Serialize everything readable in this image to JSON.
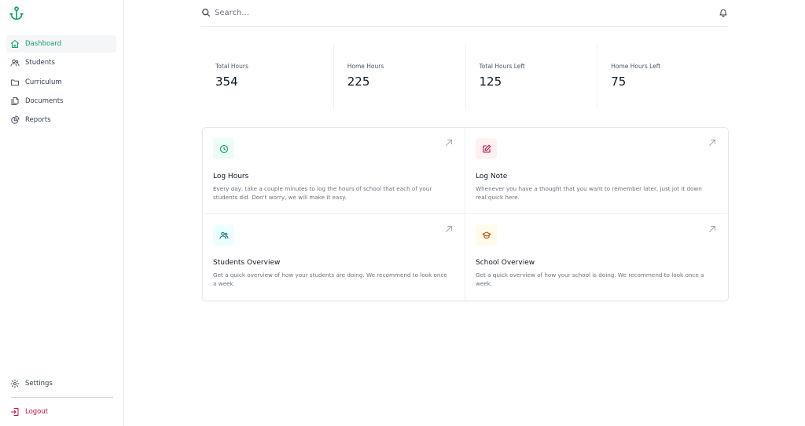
{
  "sidebar": {
    "items": [
      {
        "label": "Dashboard",
        "icon": "home-icon",
        "active": true
      },
      {
        "label": "Students",
        "icon": "users-icon"
      },
      {
        "label": "Curriculum",
        "icon": "folder-icon"
      },
      {
        "label": "Documents",
        "icon": "documents-icon"
      },
      {
        "label": "Reports",
        "icon": "pie-chart-icon"
      }
    ],
    "settings_label": "Settings",
    "logout_label": "Logout"
  },
  "header": {
    "search_placeholder": "Search..."
  },
  "stats": [
    {
      "label": "Total Hours",
      "value": "354"
    },
    {
      "label": "Home Hours",
      "value": "225"
    },
    {
      "label": "Total Hours Left",
      "value": "125"
    },
    {
      "label": "Home Hours Left",
      "value": "75"
    }
  ],
  "cards": [
    {
      "title": "Log Hours",
      "description": "Every day, take a couple minutes to log the hours of school that each of your students did. Don't worry, we will make it easy.",
      "icon": "clock-icon",
      "icon_color": "#0f9f6e",
      "icon_bg": "#ecfdf5"
    },
    {
      "title": "Log Note",
      "description": "Whenever you have a thought that you want to remember later, just jot it down real quick here.",
      "icon": "pencil-square-icon",
      "icon_color": "#be123c",
      "icon_bg": "#fff1f2"
    },
    {
      "title": "Students Overview",
      "description": "Get a quick overview of how your students are doing. We recommend to look once a week.",
      "icon": "users-icon",
      "icon_color": "#0e7490",
      "icon_bg": "#ecfeff"
    },
    {
      "title": "School Overview",
      "description": "Get a quick overview of how your school is doing. We recommend to look once a week.",
      "icon": "graduation-cap-icon",
      "icon_color": "#b45309",
      "icon_bg": "#fffbeb"
    }
  ],
  "colors": {
    "accent": "#0f9f6e",
    "logout": "#be123c"
  }
}
